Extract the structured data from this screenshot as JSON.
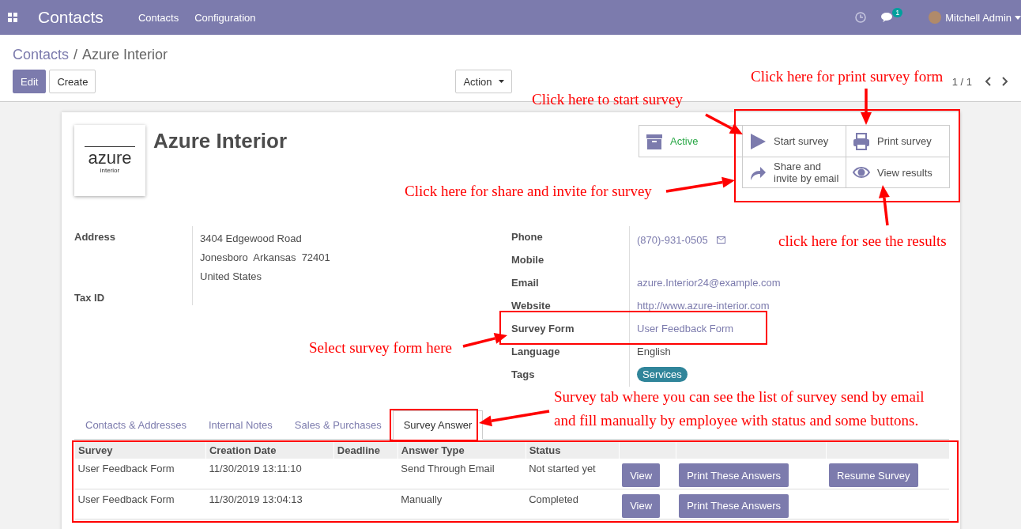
{
  "navbar": {
    "app_title": "Contacts",
    "menu": [
      "Contacts",
      "Configuration"
    ],
    "message_count": "1",
    "user": "Mitchell Admin"
  },
  "control_panel": {
    "breadcrumb": [
      {
        "label": "Contacts",
        "link": true
      },
      {
        "label": "Azure Interior",
        "link": false
      }
    ],
    "separator": "/",
    "buttons": [
      "Edit",
      "Create"
    ],
    "action": "Action",
    "pager": "1 / 1"
  },
  "sheet": {
    "title": "Azure Interior",
    "logo": {
      "word": "azure",
      "sub": "interior"
    },
    "button_box": [
      {
        "kind": "toggle",
        "label": "Active"
      },
      {
        "kind": "action",
        "label": "Start survey"
      },
      {
        "kind": "action",
        "label": "Print survey"
      },
      {
        "kind": "empty"
      },
      {
        "kind": "action",
        "label": "Share and invite by email"
      },
      {
        "kind": "action",
        "label": "View results"
      }
    ],
    "fields_left": [
      {
        "label": "Address",
        "kind": "lines",
        "lines": [
          "3404 Edgewood Road",
          "Jonesboro  Arkansas  72401",
          "United States"
        ]
      },
      {
        "label": "Tax ID",
        "kind": "empty"
      }
    ],
    "fields_right": [
      {
        "label": "Phone",
        "kind": "phone",
        "value": "(870)-931-0505"
      },
      {
        "label": "Mobile",
        "kind": "empty"
      },
      {
        "label": "Email",
        "kind": "link",
        "value": "azure.Interior24@example.com"
      },
      {
        "label": "Website",
        "kind": "link",
        "value": "http://www.azure-interior.com"
      },
      {
        "label": "Survey Form",
        "kind": "link",
        "value": "User Feedback Form"
      },
      {
        "label": "Language",
        "kind": "text",
        "value": "English"
      },
      {
        "label": "Tags",
        "kind": "tag",
        "value": "Services"
      }
    ]
  },
  "tabs": [
    {
      "label": "Contacts & Addresses",
      "selected": false
    },
    {
      "label": "Internal Notes",
      "selected": false
    },
    {
      "label": "Sales & Purchases",
      "selected": false
    },
    {
      "label": "Survey Answer",
      "selected": true
    }
  ],
  "table": {
    "columns": [
      "Survey",
      "Creation Date",
      "Deadline",
      "Answer Type",
      "Status"
    ],
    "rows": [
      {
        "cells": [
          "User Feedback Form",
          "11/30/2019 13:11:10",
          "",
          "Send Through Email",
          "Not started yet"
        ],
        "actions": [
          "View",
          "Print These Answers",
          "Resume Survey"
        ]
      },
      {
        "cells": [
          "User Feedback Form",
          "11/30/2019 13:04:13",
          "",
          "Manually",
          "Completed"
        ],
        "actions": [
          "View",
          "Print These Answers"
        ]
      }
    ]
  },
  "annotations": [
    "Click here for print survey form",
    "Click here to start survey",
    "Click here for share and invite for survey",
    "click here for see the results",
    "Select survey form here",
    "Survey tab where you can see the list of survey send by email and fill manually by employee with status and some buttons."
  ]
}
